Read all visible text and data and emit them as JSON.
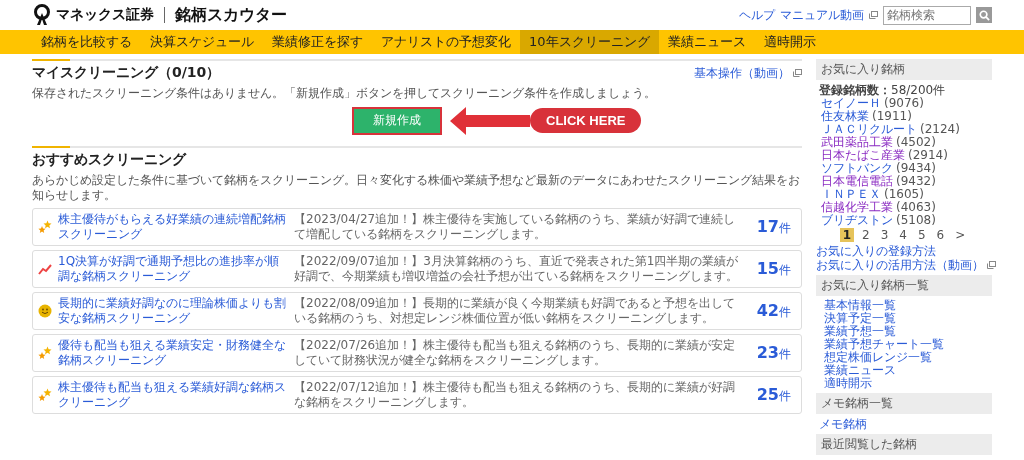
{
  "header": {
    "brand": "マネックス証券",
    "app_title": "銘柄スカウター",
    "links": [
      "ヘルプ",
      "マニュアル動画"
    ],
    "search": {
      "placeholder": "銘柄検索"
    }
  },
  "nav": [
    {
      "label": "銘柄を比較する",
      "selected": false
    },
    {
      "label": "決算スケジュール",
      "selected": false
    },
    {
      "label": "業績修正を探す",
      "selected": false
    },
    {
      "label": "アナリストの予想変化",
      "selected": false
    },
    {
      "label": "10年スクリーニング",
      "selected": true
    },
    {
      "label": "業績ニュース",
      "selected": false
    },
    {
      "label": "適時開示",
      "selected": false
    }
  ],
  "my_screening": {
    "title": "マイスクリーニング（0/10）",
    "help_link": "基本操作（動画）",
    "message": "保存されたスクリーニング条件はありません。「新規作成」ボタンを押してスクリーニング条件を作成しましょう。",
    "new_button": "新規作成",
    "callout": "CLICK HERE"
  },
  "recommended": {
    "title": "おすすめスクリーニング",
    "description": "あらかじめ設定した条件に基づいて銘柄をスクリーニング。日々変化する株価や業績予想など最新のデータにあわせたスクリーニング結果をお知らせします。",
    "rows": [
      {
        "kind": "stars",
        "title": "株主優待がもらえる好業績の連続増配銘柄スクリーニング",
        "description": "【2023/04/27追加！】株主優待を実施している銘柄のうち、業績が好調で連続して増配している銘柄をスクリーニングします。",
        "count": "17",
        "unit": "件"
      },
      {
        "kind": "trend",
        "title": "1Q決算が好調で通期予想比の進捗率が順調な銘柄スクリーニング",
        "description": "【2022/09/07追加！】3月決算銘柄のうち、直近で発表された第1四半期の業績が好調で、今期業績も増収増益の会社予想が出ている銘柄をスクリーニングします。",
        "count": "15",
        "unit": "件"
      },
      {
        "kind": "smile",
        "title": "長期的に業績好調なのに理論株価よりも割安な銘柄スクリーニング",
        "description": "【2022/08/09追加！】長期的に業績が良く今期業績も好調であると予想を出している銘柄のうち、対想定レンジ株価位置が低い銘柄をスクリーニングします。",
        "count": "42",
        "unit": "件"
      },
      {
        "kind": "stars",
        "title": "優待も配当も狙える業績安定・財務健全な銘柄スクリーニング",
        "description": "【2022/07/26追加！】株主優待も配当も狙える銘柄のうち、長期的に業績が安定していて財務状況が健全な銘柄をスクリーニングします。",
        "count": "23",
        "unit": "件"
      },
      {
        "kind": "stars",
        "title": "株主優待も配当も狙える業績好調な銘柄スクリーニング",
        "description": "【2022/07/12追加！】株主優待も配当も狙える銘柄のうち、長期的に業績が好調な銘柄をスクリーニングします。",
        "count": "25",
        "unit": "件"
      }
    ]
  },
  "sidebar": {
    "favorites": {
      "title": "お気に入り銘柄",
      "count_label": "登録銘柄数：",
      "count": "58/200件",
      "items": [
        {
          "name": "セイノーＨ",
          "code": "(9076)",
          "visited": false
        },
        {
          "name": "住友林業",
          "code": "(1911)",
          "visited": false
        },
        {
          "name": "ＪＡＣリクルート",
          "code": "(2124)",
          "visited": false
        },
        {
          "name": "武田薬品工業",
          "code": "(4502)",
          "visited": true
        },
        {
          "name": "日本たばこ産業",
          "code": "(2914)",
          "visited": true
        },
        {
          "name": "ソフトバンク",
          "code": "(9434)",
          "visited": false
        },
        {
          "name": "日本電信電話",
          "code": "(9432)",
          "visited": true
        },
        {
          "name": "ＩＮＰＥＸ",
          "code": "(1605)",
          "visited": false
        },
        {
          "name": "信越化学工業",
          "code": "(4063)",
          "visited": true
        },
        {
          "name": "ブリヂストン",
          "code": "(5108)",
          "visited": false
        }
      ],
      "pages": [
        {
          "label": "1",
          "selected": true
        },
        {
          "label": "2",
          "selected": false
        },
        {
          "label": "3",
          "selected": false
        },
        {
          "label": "4",
          "selected": false
        },
        {
          "label": "5",
          "selected": false
        },
        {
          "label": "6",
          "selected": false
        },
        {
          "label": ">",
          "selected": false
        }
      ],
      "links": [
        {
          "label": "お気に入りの登録方法",
          "external": false
        },
        {
          "label": "お気に入りの活用方法（動画）",
          "external": true
        }
      ]
    },
    "list_views": {
      "title": "お気に入り銘柄一覧",
      "items": [
        "基本情報一覧",
        "決算予定一覧",
        "業績予想一覧",
        "業績予想チャート一覧",
        "想定株価レンジ一覧",
        "業績ニュース",
        "適時開示"
      ]
    },
    "memo": {
      "title": "メモ銘柄一覧",
      "items": [
        "メモ銘柄"
      ]
    },
    "recent": {
      "title": "最近閲覧した銘柄"
    }
  }
}
